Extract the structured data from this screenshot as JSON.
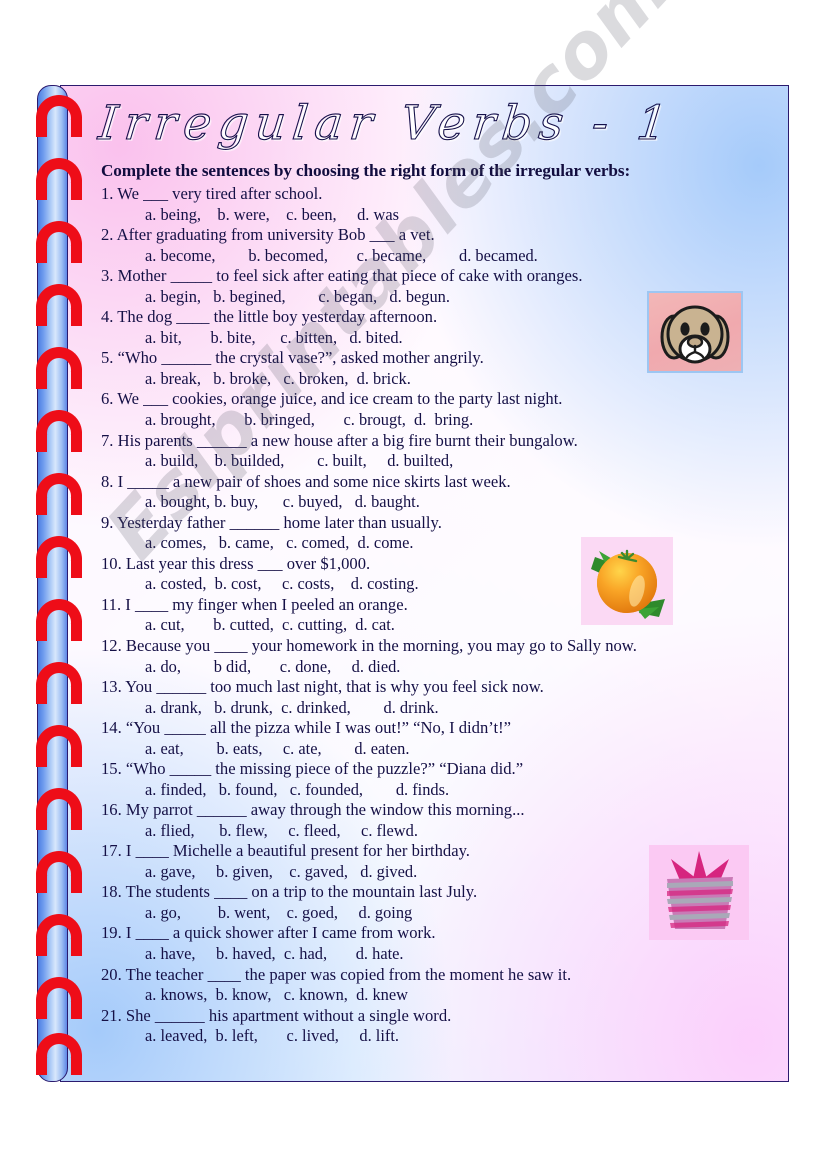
{
  "worksheet": {
    "title": "Irregular Verbs - 1",
    "instructions": "Complete the sentences by choosing the right form of the irregular verbs:",
    "watermark": "Eslprintables.com",
    "colors": {
      "gradient_top_left": "#f9c7ec",
      "gradient_top_right": "#a8cbf9",
      "gradient_bottom_left": "#a8cbf9",
      "gradient_bottom_right": "#fccdfc",
      "border": "#2b1a6e",
      "spiral_ring": "#ee0d18",
      "text": "#151046"
    },
    "questions": [
      {
        "prompt": "1. We ___ very tired after school.",
        "options": "a. being,    b. were,    c. been,     d. was"
      },
      {
        "prompt": "2. After graduating from university Bob ___ a vet.",
        "options": "a. become,        b. becomed,       c. became,        d. becamed."
      },
      {
        "prompt": "3. Mother _____ to feel sick after eating that piece of cake with oranges.",
        "options": "a. begin,   b. begined,        c. began,   d. begun."
      },
      {
        "prompt": "4. The dog ____ the little boy yesterday afternoon.",
        "options": "a. bit,       b. bite,      c. bitten,   d. bited."
      },
      {
        "prompt": "5. “Who ______ the crystal vase?”, asked mother angrily.",
        "options": "a. break,   b. broke,   c. broken,  d. brick."
      },
      {
        "prompt": "6. We ___ cookies, orange juice, and ice cream to the party last night.",
        "options": "a. brought,       b. bringed,       c. brougt,  d.  bring."
      },
      {
        "prompt": "7. His parents ______ a new house after a big fire burnt their bungalow.",
        "options": "a. build,    b. builded,        c. built,     d. builted,"
      },
      {
        "prompt": "8. I _____ a new pair of shoes and some nice skirts last week.",
        "options": "a. bought, b. buy,      c. buyed,   d. baught."
      },
      {
        "prompt": "9. Yesterday father ______ home later than usually.",
        "options": "a. comes,   b. came,   c. comed,  d. come."
      },
      {
        "prompt": "10. Last year this dress ___ over $1,000.",
        "options": "a. costed,  b. cost,     c. costs,    d. costing."
      },
      {
        "prompt": "11. I ____ my finger when I peeled an orange.",
        "options": "a. cut,       b. cutted,  c. cutting,  d. cat."
      },
      {
        "prompt": "12. Because you ____ your homework in the morning, you may go to Sally now.",
        "options": "a. do,        b did,       c. done,     d. died."
      },
      {
        "prompt": "13. You ______ too much last night, that is why you feel sick now.",
        "options": "a. drank,   b. drunk,  c. drinked,        d. drink."
      },
      {
        "prompt": "14. “You _____ all the pizza while I was out!” “No, I didn’t!”",
        "options": "a. eat,        b. eats,     c. ate,        d. eaten."
      },
      {
        "prompt": "15. “Who _____ the missing piece of the puzzle?” “Diana did.”",
        "options": "a. finded,   b. found,   c. founded,        d. finds."
      },
      {
        "prompt": "16. My parrot ______ away through the window this morning...",
        "options": "a. flied,      b. flew,     c. fleed,     c. flewd."
      },
      {
        "prompt": "17. I ____ Michelle a beautiful present for her birthday.",
        "options": "a. gave,     b. given,    c. gaved,   d. gived."
      },
      {
        "prompt": "18. The students ____ on a trip to the mountain last July.",
        "options": "a. go,         b. went,    c. goed,     d. going"
      },
      {
        "prompt": "19. I ____ a quick shower after I came from work.",
        "options": "a. have,     b. haved,  c. had,       d. hate."
      },
      {
        "prompt": "20. The teacher ____ the paper was copied from the moment he saw it.",
        "options": "a. knows,  b. know,   c. known,  d. knew"
      },
      {
        "prompt": "21. She ______ his apartment without a single word.",
        "options": "a. leaved,  b. left,       c. lived,     d. lift."
      }
    ],
    "clipart": [
      {
        "name": "dog-clipart",
        "label": "dog"
      },
      {
        "name": "orange-clipart",
        "label": "orange"
      },
      {
        "name": "gift-clipart",
        "label": "gift box"
      }
    ]
  }
}
